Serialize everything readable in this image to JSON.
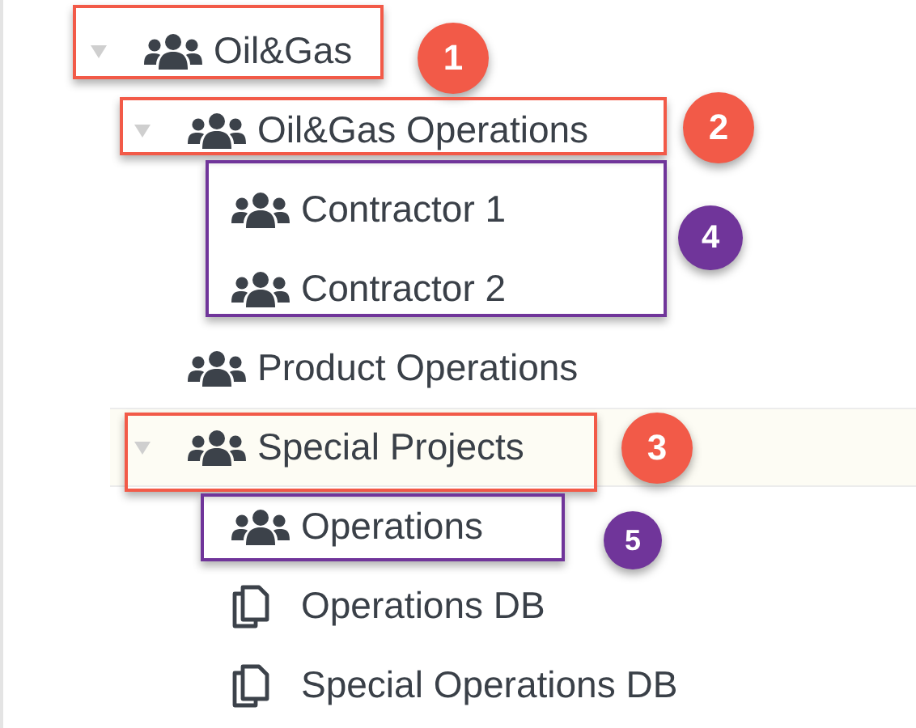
{
  "tree": [
    {
      "label": "Oil&Gas",
      "kind": "group",
      "expanded": true,
      "selected": false,
      "children": [
        {
          "label": "Oil&Gas Operations",
          "kind": "group",
          "expanded": true,
          "selected": false,
          "children": [
            {
              "label": "Contractor 1",
              "kind": "group",
              "selected": false
            },
            {
              "label": "Contractor 2",
              "kind": "group",
              "selected": false
            }
          ]
        },
        {
          "label": "Product Operations",
          "kind": "group",
          "selected": false
        },
        {
          "label": "Special Projects",
          "kind": "group",
          "expanded": true,
          "selected": true,
          "children": [
            {
              "label": "Operations",
              "kind": "group",
              "selected": false
            },
            {
              "label": "Operations DB",
              "kind": "document",
              "selected": false
            },
            {
              "label": "Special Operations DB",
              "kind": "document",
              "selected": false
            }
          ]
        }
      ]
    }
  ],
  "callouts": [
    {
      "label": "1",
      "color": "#f25a48"
    },
    {
      "label": "2",
      "color": "#f25a48"
    },
    {
      "label": "4",
      "color": "#70359a"
    },
    {
      "label": "3",
      "color": "#f25a48"
    },
    {
      "label": "5",
      "color": "#70359a"
    }
  ]
}
